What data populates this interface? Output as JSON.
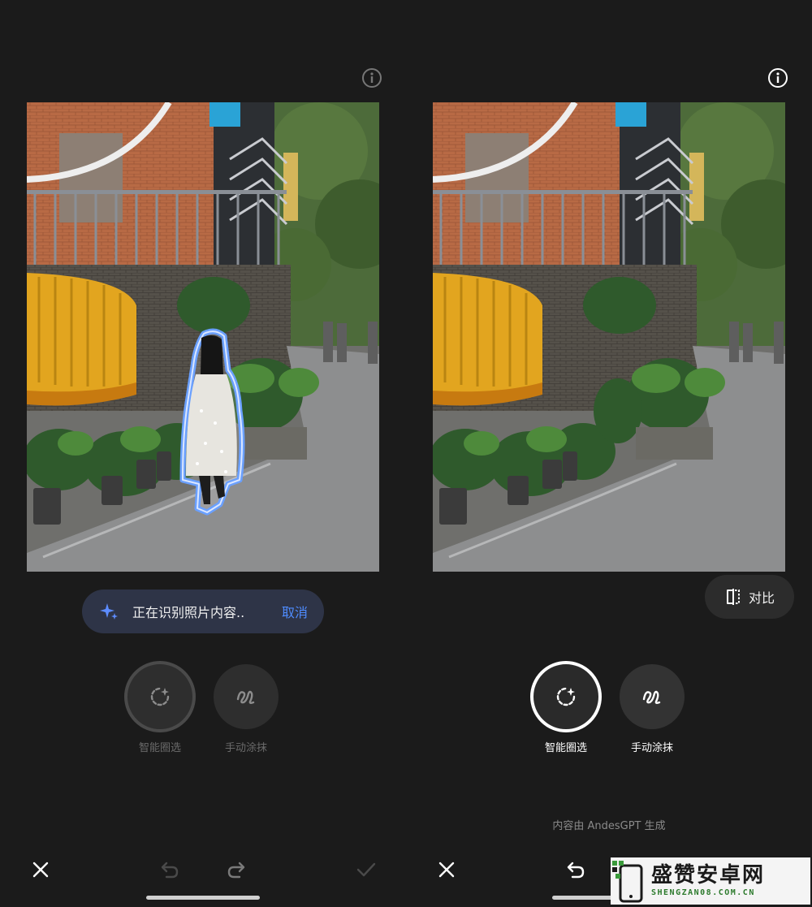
{
  "left_panel": {
    "toast": {
      "message": "正在识别照片内容..",
      "cancel_label": "取消"
    },
    "tools": [
      {
        "label": "智能圈选",
        "icon": "smart-select-icon",
        "selected": true
      },
      {
        "label": "手动涂抹",
        "icon": "brush-icon",
        "selected": false
      }
    ],
    "toolbar": {
      "close_icon": "close-icon",
      "undo_icon": "undo-icon",
      "redo_icon": "redo-icon",
      "confirm_icon": "checkmark-icon"
    }
  },
  "right_panel": {
    "compare_label": "对比",
    "tools": [
      {
        "label": "智能圈选",
        "icon": "smart-select-icon",
        "selected": true
      },
      {
        "label": "手动涂抹",
        "icon": "brush-icon",
        "selected": false
      }
    ],
    "footer_note": "内容由 AndesGPT 生成",
    "toolbar": {
      "close_icon": "close-icon",
      "undo_icon": "undo-icon"
    }
  },
  "watermark": {
    "title": "盛赞安卓网",
    "subtitle": "SHENGZAN08.COM.CN"
  },
  "colors": {
    "background": "#1b1b1b",
    "accent": "#4f8cff",
    "toast_bg": "#2e3447"
  }
}
